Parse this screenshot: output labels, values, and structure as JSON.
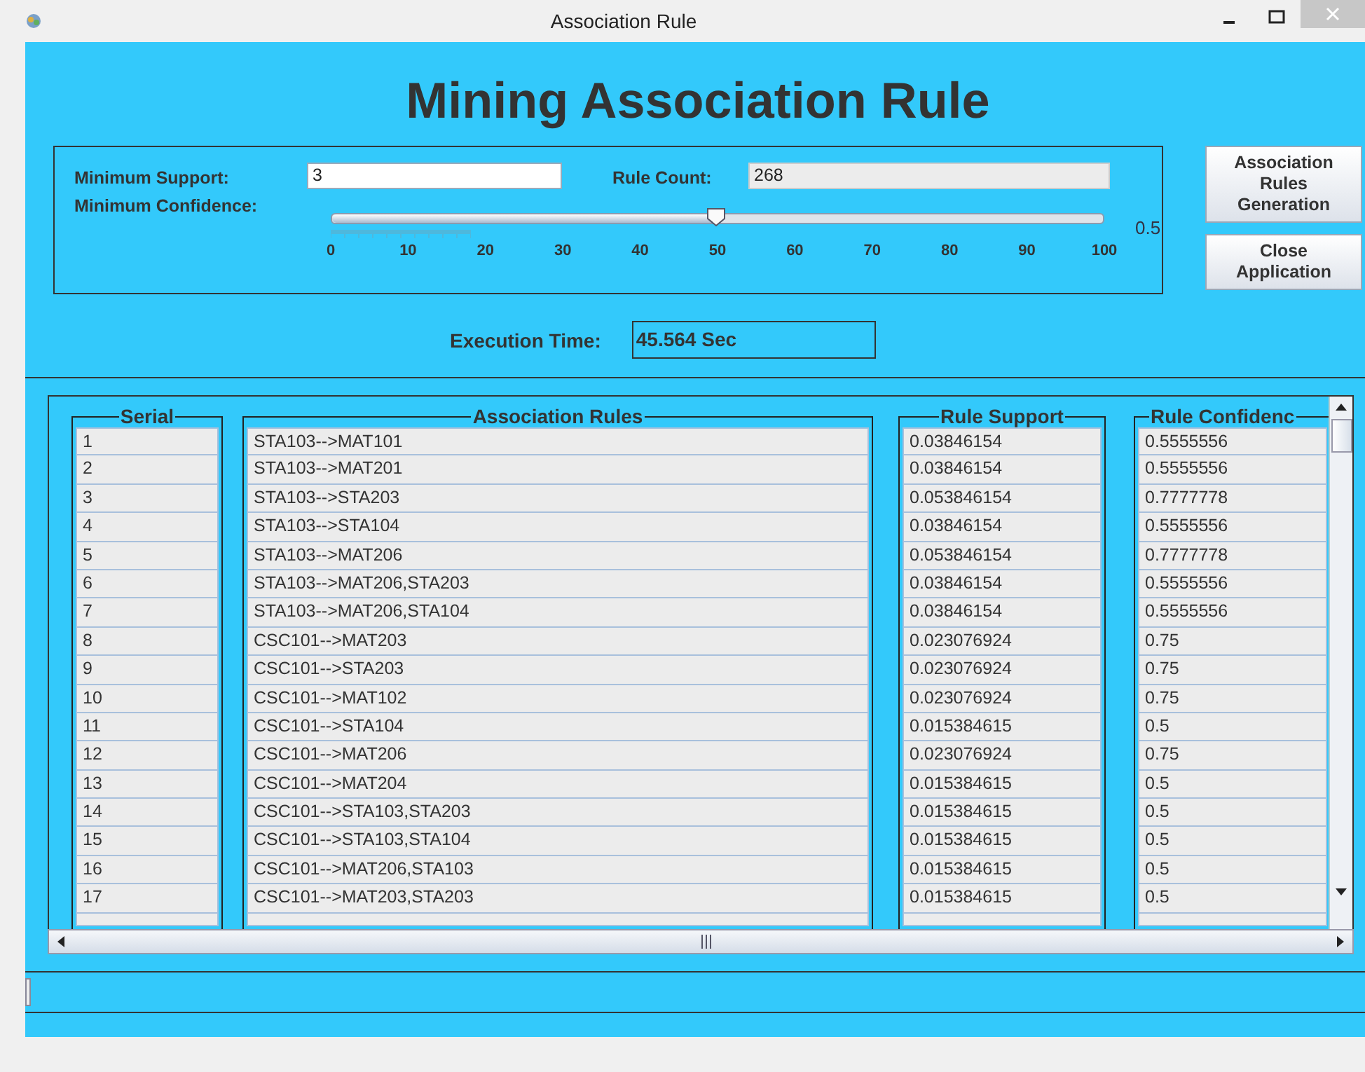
{
  "window": {
    "title": "Association Rule"
  },
  "heading": "Mining Association Rule",
  "settings": {
    "min_support_label": "Minimum Support:",
    "min_support_value": "3",
    "rule_count_label": "Rule Count:",
    "rule_count_value": "268",
    "min_confidence_label": "Minimum Confidence:",
    "confidence_slider": {
      "level": 0.5,
      "tick_labels": [
        "0",
        "10",
        "20",
        "30",
        "40",
        "50",
        "60",
        "70",
        "80",
        "90",
        "100"
      ],
      "reading": "0.5"
    }
  },
  "buttons": [
    "Association Rules Generation",
    "Close Application"
  ],
  "execution": {
    "label": "Execution Time:",
    "value": "45.564 Sec"
  },
  "table": {
    "columns": [
      "Serial",
      "Association Rules",
      "Rule Support",
      "Rule Confidenc"
    ],
    "rows": [
      [
        "1",
        "STA103-->MAT101",
        "0.03846154",
        "0.5555556"
      ],
      [
        "2",
        "STA103-->MAT201",
        "0.03846154",
        "0.5555556"
      ],
      [
        "3",
        "STA103-->STA203",
        "0.053846154",
        "0.7777778"
      ],
      [
        "4",
        "STA103-->STA104",
        "0.03846154",
        "0.5555556"
      ],
      [
        "5",
        "STA103-->MAT206",
        "0.053846154",
        "0.7777778"
      ],
      [
        "6",
        "STA103-->MAT206,STA203",
        "0.03846154",
        "0.5555556"
      ],
      [
        "7",
        "STA103-->MAT206,STA104",
        "0.03846154",
        "0.5555556"
      ],
      [
        "8",
        "CSC101-->MAT203",
        "0.023076924",
        "0.75"
      ],
      [
        "9",
        "CSC101-->STA203",
        "0.023076924",
        "0.75"
      ],
      [
        "10",
        "CSC101-->MAT102",
        "0.023076924",
        "0.75"
      ],
      [
        "11",
        "CSC101-->STA104",
        "0.015384615",
        "0.5"
      ],
      [
        "12",
        "CSC101-->MAT206",
        "0.023076924",
        "0.75"
      ],
      [
        "13",
        "CSC101-->MAT204",
        "0.015384615",
        "0.5"
      ],
      [
        "14",
        "CSC101-->STA103,STA203",
        "0.015384615",
        "0.5"
      ],
      [
        "15",
        "CSC101-->STA103,STA104",
        "0.015384615",
        "0.5"
      ],
      [
        "16",
        "CSC101-->MAT206,STA103",
        "0.015384615",
        "0.5"
      ],
      [
        "17",
        "CSC101-->MAT203,STA203",
        "0.015384615",
        "0.5"
      ]
    ]
  }
}
